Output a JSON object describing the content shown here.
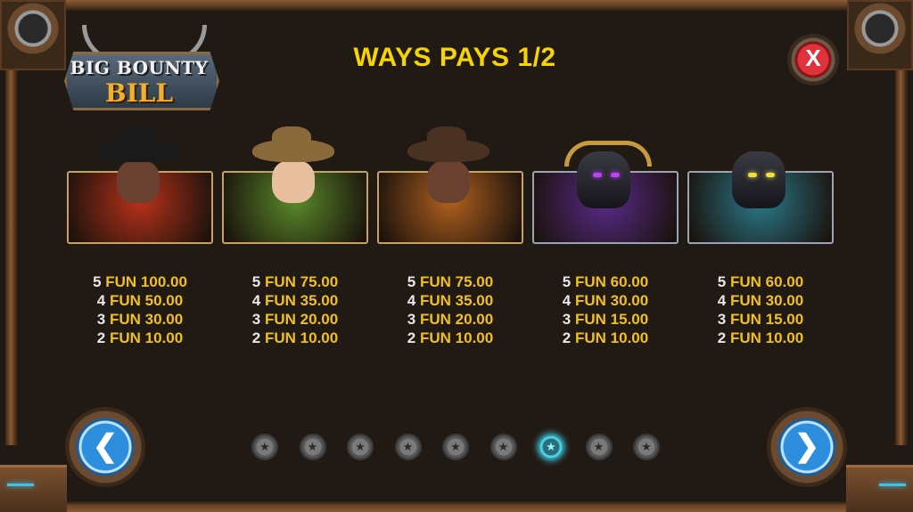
{
  "logo": {
    "line1": "BIG BOUNTY",
    "line2": "BILL"
  },
  "title": "WAYS PAYS 1/2",
  "close_label": "X",
  "nav": {
    "prev_icon": "chevron-left-icon",
    "next_icon": "chevron-right-icon",
    "prev_glyph": "❮",
    "next_glyph": "❯"
  },
  "symbols": [
    {
      "name": "masked-gunslinger",
      "bg": "#b8321a",
      "payouts": [
        {
          "count": "5",
          "amount": "FUN 100.00"
        },
        {
          "count": "4",
          "amount": "FUN 50.00"
        },
        {
          "count": "3",
          "amount": "FUN 30.00"
        },
        {
          "count": "2",
          "amount": "FUN 10.00"
        }
      ]
    },
    {
      "name": "cowgirl",
      "bg": "#5a8a2a",
      "payouts": [
        {
          "count": "5",
          "amount": "FUN 75.00"
        },
        {
          "count": "4",
          "amount": "FUN 35.00"
        },
        {
          "count": "3",
          "amount": "FUN 20.00"
        },
        {
          "count": "2",
          "amount": "FUN 10.00"
        }
      ]
    },
    {
      "name": "cowboy",
      "bg": "#b0601e",
      "payouts": [
        {
          "count": "5",
          "amount": "FUN 75.00"
        },
        {
          "count": "4",
          "amount": "FUN 35.00"
        },
        {
          "count": "3",
          "amount": "FUN 20.00"
        },
        {
          "count": "2",
          "amount": "FUN 10.00"
        }
      ]
    },
    {
      "name": "robot-bull",
      "bg": "#5a2a8a",
      "payouts": [
        {
          "count": "5",
          "amount": "FUN 60.00"
        },
        {
          "count": "4",
          "amount": "FUN 30.00"
        },
        {
          "count": "3",
          "amount": "FUN 15.00"
        },
        {
          "count": "2",
          "amount": "FUN 10.00"
        }
      ]
    },
    {
      "name": "robot-horse",
      "bg": "#2a7a8a",
      "payouts": [
        {
          "count": "5",
          "amount": "FUN 60.00"
        },
        {
          "count": "4",
          "amount": "FUN 30.00"
        },
        {
          "count": "3",
          "amount": "FUN 15.00"
        },
        {
          "count": "2",
          "amount": "FUN 10.00"
        }
      ]
    }
  ],
  "pager": {
    "total": 9,
    "active_index": 6,
    "dot_glyph": "★"
  }
}
